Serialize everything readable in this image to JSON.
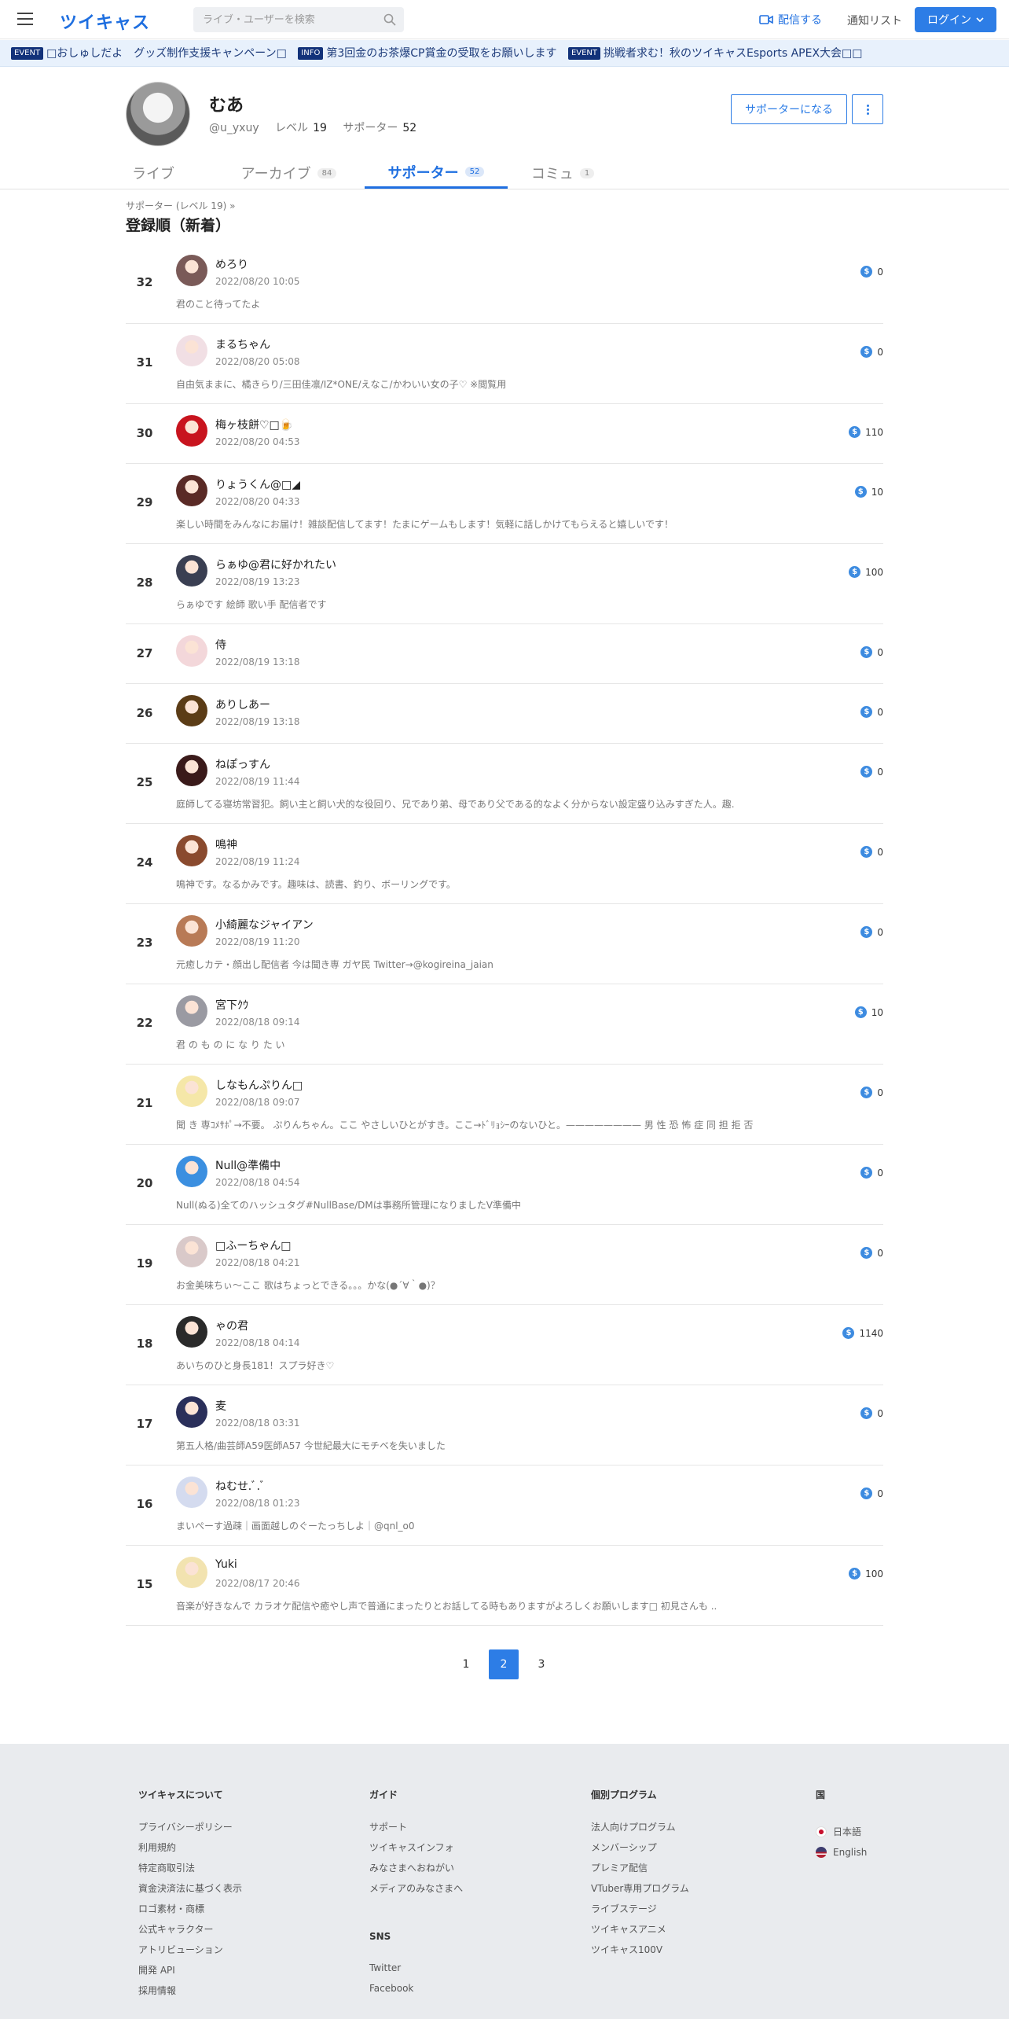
{
  "header": {
    "logo": "ツイキャス",
    "search_placeholder": "ライブ・ユーザーを検索",
    "broadcast_label": "配信する",
    "notify_label": "通知リスト",
    "login_label": "ログイン"
  },
  "ticker": [
    {
      "tag": "EVENT",
      "text": "□おしゅしだよ　グッズ制作支援キャンペーン□"
    },
    {
      "tag": "INFO",
      "text": "第3回金のお茶爆CP賞金の受取をお願いします"
    },
    {
      "tag": "EVENT",
      "text": "挑戦者求む！秋のツイキャスEsports APEX大会□□"
    }
  ],
  "profile": {
    "name": "むあ",
    "user_id": "@u_yxuy",
    "level_label": "レベル",
    "level": "19",
    "supporters_label": "サポーター",
    "supporters": "52",
    "support_button": "サポーターになる"
  },
  "tabs": [
    {
      "label": "ライブ",
      "count": ""
    },
    {
      "label": "アーカイブ",
      "count": "84"
    },
    {
      "label": "サポーター",
      "count": "52"
    },
    {
      "label": "コミュ",
      "count": "1"
    }
  ],
  "breadcrumb": "サポーター (レベル 19) »",
  "section_title": "登録順（新着）",
  "supporters": [
    {
      "rank": "32",
      "name": "めろり",
      "date": "2022/08/20 10:05",
      "bio": "君のこと待ってたよ",
      "points": "0",
      "color": "#7a5a58"
    },
    {
      "rank": "31",
      "name": "まるちゃん",
      "date": "2022/08/20 05:08",
      "bio": "自由気ままに、橘きらり/三田佳凛/IZ*ONE/えなこ/かわいい女の子♡ ※閲覧用",
      "points": "0",
      "color": "#f1dfe4"
    },
    {
      "rank": "30",
      "name": "梅ヶ枝餅♡□🍺",
      "date": "2022/08/20 04:53",
      "bio": "",
      "points": "110",
      "color": "#c8141e"
    },
    {
      "rank": "29",
      "name": "りょうくん@□◢",
      "date": "2022/08/20 04:33",
      "bio": "楽しい時間をみんなにお届け！雑談配信してます！たまにゲームもします！気軽に話しかけてもらえると嬉しいです！",
      "points": "10",
      "color": "#5a2a26"
    },
    {
      "rank": "28",
      "name": "らぁゆ@君に好かれたい",
      "date": "2022/08/19 13:23",
      "bio": "らぁゆです 絵師 歌い手 配信者です",
      "points": "100",
      "color": "#3a3f52"
    },
    {
      "rank": "27",
      "name": "侍",
      "date": "2022/08/19 13:18",
      "bio": "",
      "points": "0",
      "color": "#f3d7da"
    },
    {
      "rank": "26",
      "name": "ありしあー",
      "date": "2022/08/19 13:18",
      "bio": "",
      "points": "0",
      "color": "#5b3c16"
    },
    {
      "rank": "25",
      "name": "ねぽっすん",
      "date": "2022/08/19 11:44",
      "bio": "庭師してる寝坊常習犯。飼い主と飼い犬的な役回り、兄であり弟、母であり父である的なよく分からない設定盛り込みすぎた人。趣.",
      "points": "0",
      "color": "#3a1a1a"
    },
    {
      "rank": "24",
      "name": "鳴神",
      "date": "2022/08/19 11:24",
      "bio": "鳴神です。なるかみです。趣味は、読書、釣り、ボーリングです。",
      "points": "0",
      "color": "#8a4a2e"
    },
    {
      "rank": "23",
      "name": "小綺麗なジャイアン",
      "date": "2022/08/19 11:20",
      "bio": "元癒しカテ・顔出し配信者 今は聞き専 ガヤ民 Twitter→@kogireina_jaian",
      "points": "0",
      "color": "#b87a56"
    },
    {
      "rank": "22",
      "name": "宮下ｸｳ",
      "date": "2022/08/18 09:14",
      "bio": "君 の も の に な り た い",
      "points": "10",
      "color": "#9a9aa2"
    },
    {
      "rank": "21",
      "name": "しなもんぷりん□",
      "date": "2022/08/18 09:07",
      "bio": "聞 き 専ｺﾒｻﾎﾟ→不要。 ぷりんちゃん。ここ やさしいひとがすき。ここ→ﾄﾞﾘｮｼｰのないひと。———————— 男 性 恐 怖 症 同 担 拒 否",
      "points": "0",
      "color": "#f5e7a8"
    },
    {
      "rank": "20",
      "name": "Null@準備中",
      "date": "2022/08/18 04:54",
      "bio": "Null(ぬる)全てのハッシュタグ#NullBase/DMは事務所管理になりましたV準備中",
      "points": "0",
      "color": "#3b8fe0"
    },
    {
      "rank": "19",
      "name": "□ふーちゃん□",
      "date": "2022/08/18 04:21",
      "bio": "お金美味ちぃ～ここ 歌はちょっとできる。。。かな(●´∀｀●)？",
      "points": "0",
      "color": "#d9c9c9"
    },
    {
      "rank": "18",
      "name": "ゃの君",
      "date": "2022/08/18 04:14",
      "bio": "あいちのひと身長181！スプラ好き♡",
      "points": "1140",
      "color": "#2a2a2a"
    },
    {
      "rank": "17",
      "name": "麦",
      "date": "2022/08/18 03:31",
      "bio": "第五人格/曲芸師A59医師A57 今世紀最大にモチベを失いました",
      "points": "0",
      "color": "#2a2f5a"
    },
    {
      "rank": "16",
      "name": "ねむせ.ﾞ.ﾞ",
      "date": "2022/08/18 01:23",
      "bio": "まいぺーす過疎｜画面越しのぐーたっちしよ｜@qnl_o0",
      "points": "0",
      "color": "#d4dbef"
    },
    {
      "rank": "15",
      "name": "Yuki",
      "date": "2022/08/17 20:46",
      "bio": "音楽が好きなんで カラオケ配信や癒やし声で普通にまったりとお話してる時もありますがよろしくお願いします□ 初見さんも ..",
      "points": "100",
      "color": "#f2e3b0"
    }
  ],
  "pagination": [
    "1",
    "2",
    "3"
  ],
  "pagination_active": "2",
  "footer": {
    "col1": {
      "head": "ツイキャスについて",
      "links": [
        "プライバシーポリシー",
        "利用規約",
        "特定商取引法",
        "資金決済法に基づく表示",
        "ロゴ素材・商標",
        "公式キャラクター",
        "アトリビューション",
        "開発 API",
        "採用情報"
      ]
    },
    "col2": {
      "head": "ガイド",
      "links": [
        "サポート",
        "ツイキャスインフォ",
        "みなさまへおねがい",
        "メディアのみなさまへ"
      ]
    },
    "col2b": {
      "head": "SNS",
      "links": [
        "Twitter",
        "Facebook"
      ]
    },
    "col3": {
      "head": "個別プログラム",
      "links": [
        "法人向けプログラム",
        "メンバーシップ",
        "プレミア配信",
        "VTuber専用プログラム",
        "ライブステージ",
        "ツイキャスアニメ",
        "ツイキャス100V"
      ]
    },
    "col4": {
      "head": "国",
      "langs": [
        "日本語",
        "English"
      ]
    }
  },
  "colors": {
    "accent": "#2d7de6",
    "brand": "#1f6fe0",
    "footer_bg": "#e9ebee"
  }
}
